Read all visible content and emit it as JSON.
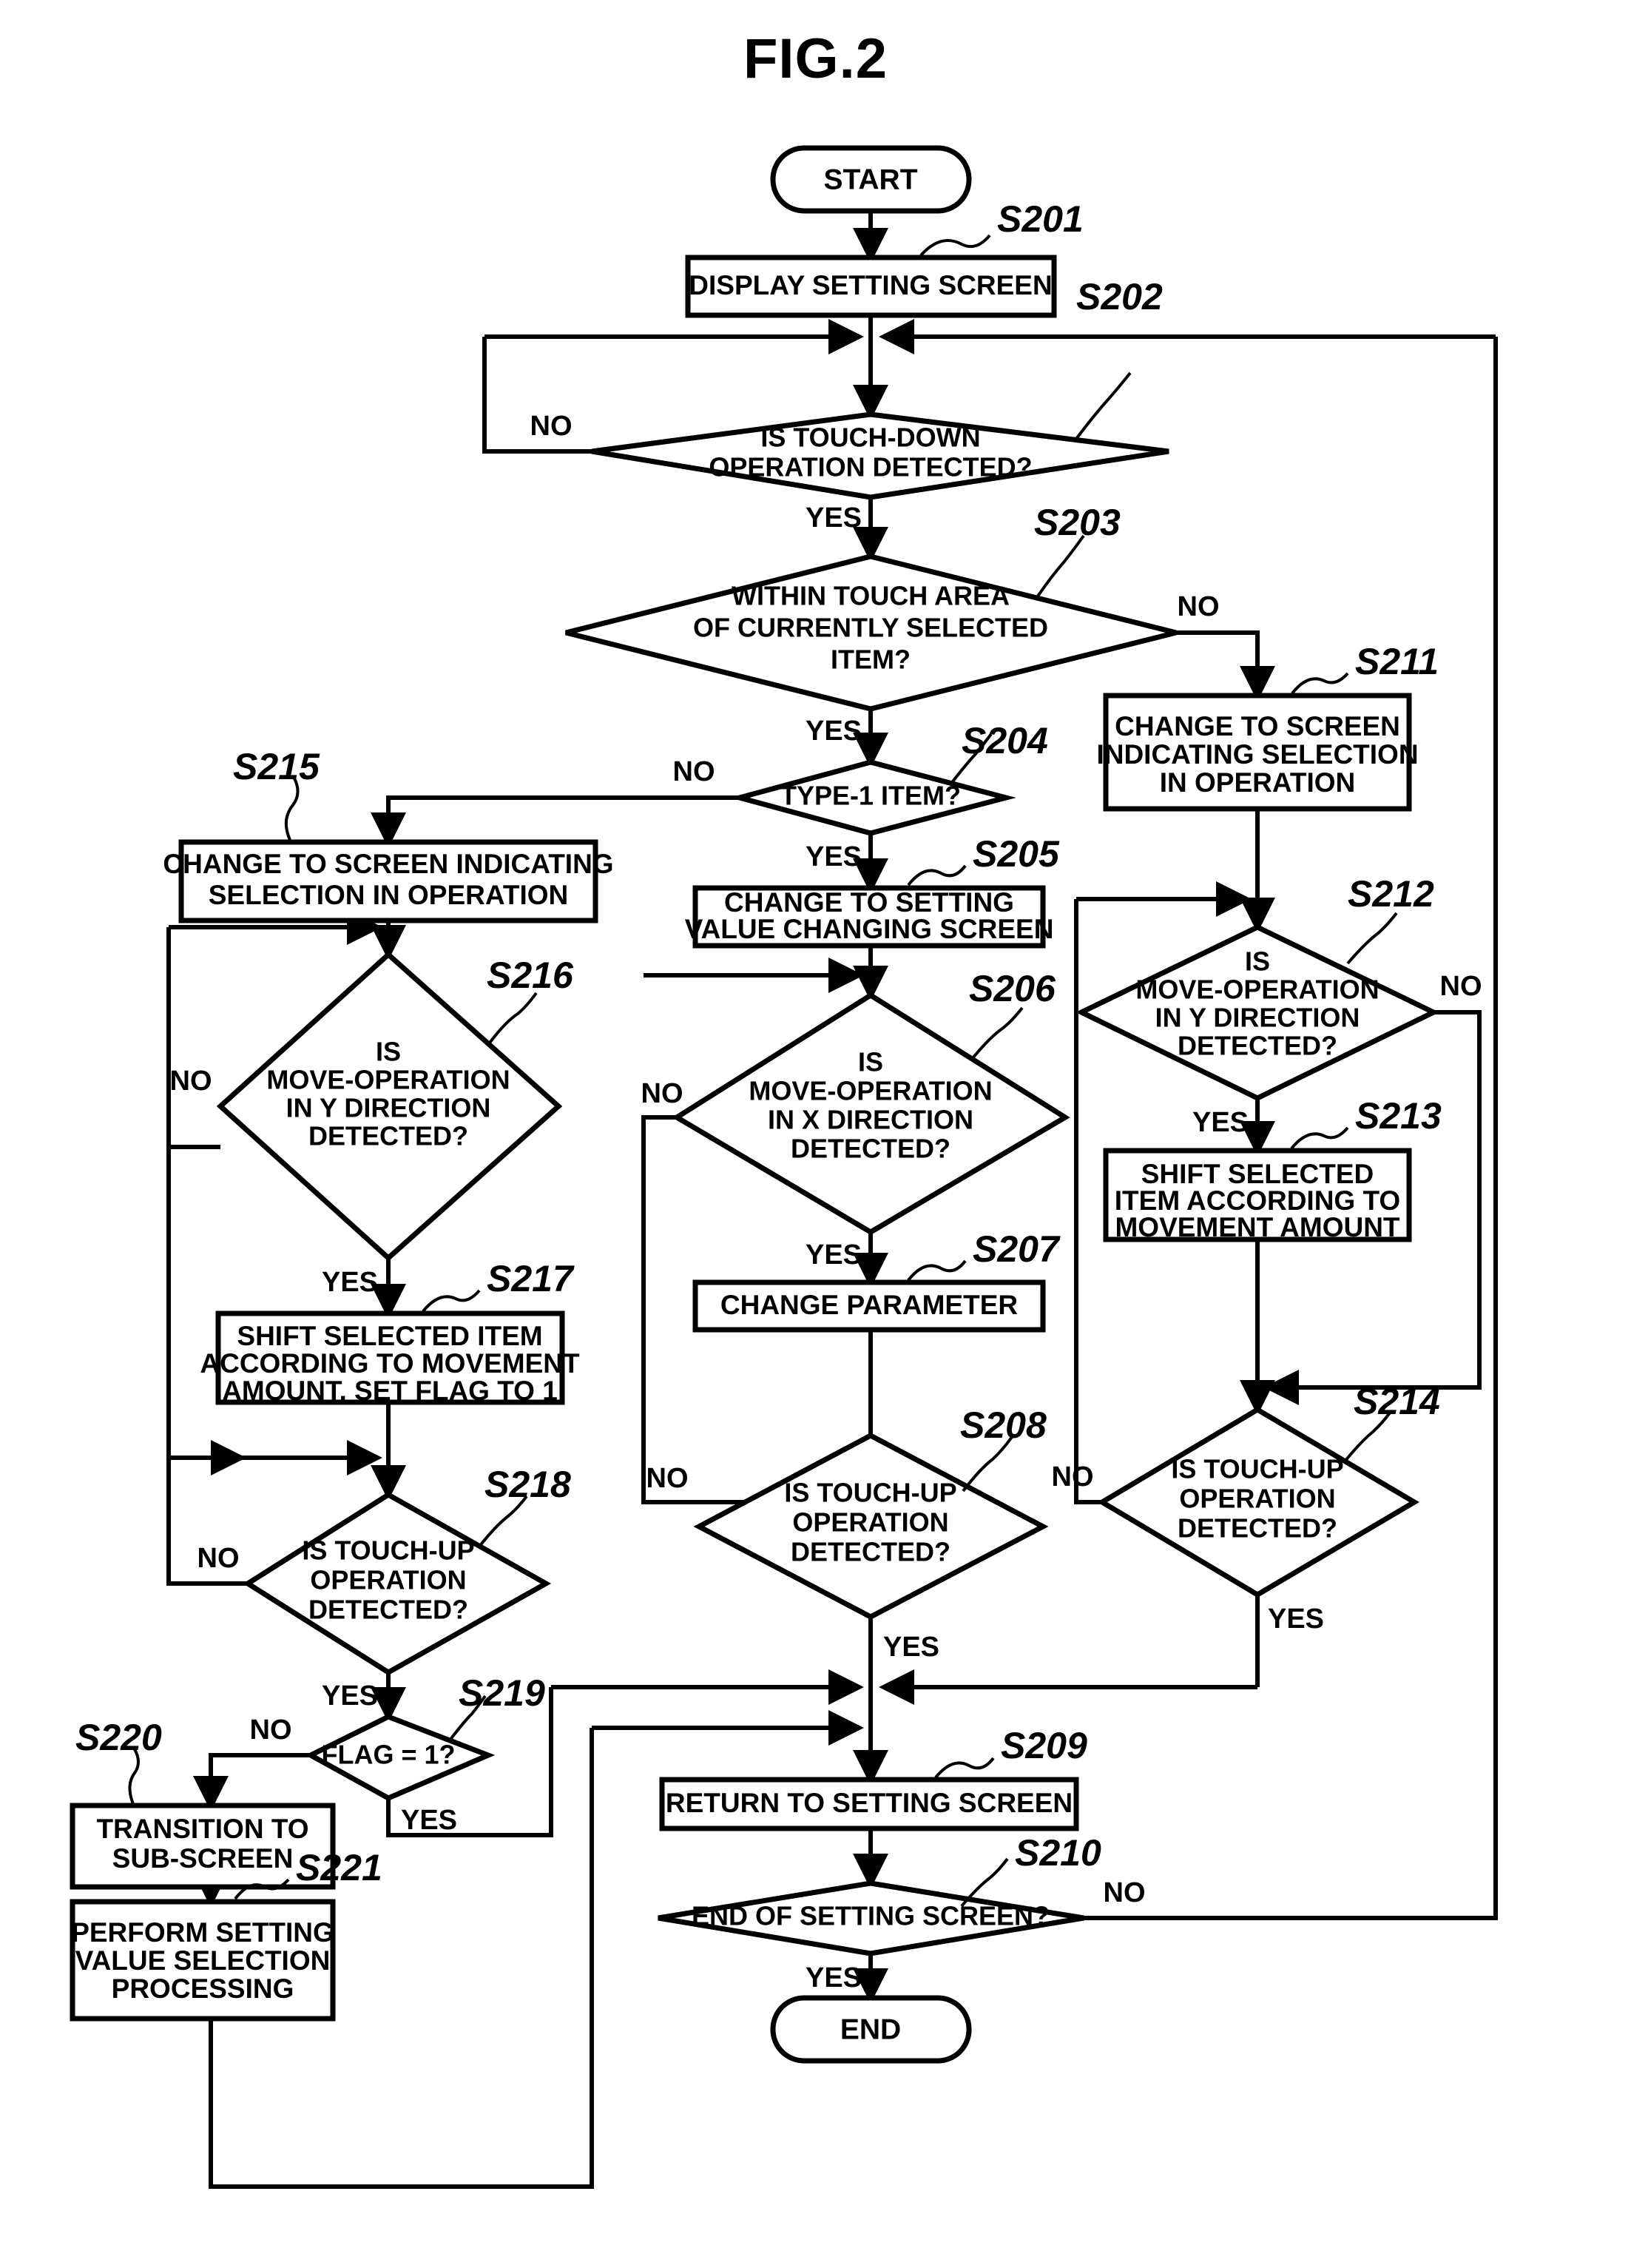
{
  "figure": {
    "title": "FIG.2"
  },
  "diagram_type": "flowchart",
  "terminals": {
    "start": "START",
    "end": "END"
  },
  "branches": {
    "yes": "YES",
    "no": "NO"
  },
  "steps": [
    {
      "id": "S201",
      "kind": "process",
      "text_lines": [
        "DISPLAY SETTING SCREEN"
      ]
    },
    {
      "id": "S202",
      "kind": "decision",
      "text_lines": [
        "IS TOUCH-DOWN",
        "OPERATION DETECTED?"
      ]
    },
    {
      "id": "S203",
      "kind": "decision",
      "text_lines": [
        "WITHIN TOUCH AREA",
        "OF CURRENTLY SELECTED",
        "ITEM?"
      ]
    },
    {
      "id": "S204",
      "kind": "decision",
      "text_lines": [
        "TYPE-1 ITEM?"
      ]
    },
    {
      "id": "S205",
      "kind": "process",
      "text_lines": [
        "CHANGE TO SETTING",
        "VALUE CHANGING SCREEN"
      ]
    },
    {
      "id": "S206",
      "kind": "decision",
      "text_lines": [
        "IS",
        "MOVE-OPERATION",
        "IN X DIRECTION",
        "DETECTED?"
      ]
    },
    {
      "id": "S207",
      "kind": "process",
      "text_lines": [
        "CHANGE PARAMETER"
      ]
    },
    {
      "id": "S208",
      "kind": "decision",
      "text_lines": [
        "IS TOUCH-UP",
        "OPERATION",
        "DETECTED?"
      ]
    },
    {
      "id": "S209",
      "kind": "process",
      "text_lines": [
        "RETURN TO SETTING SCREEN"
      ]
    },
    {
      "id": "S210",
      "kind": "decision",
      "text_lines": [
        "END OF SETTING SCREEN?"
      ]
    },
    {
      "id": "S211",
      "kind": "process",
      "text_lines": [
        "CHANGE TO SCREEN",
        "INDICATING SELECTION",
        "IN OPERATION"
      ]
    },
    {
      "id": "S212",
      "kind": "decision",
      "text_lines": [
        "IS",
        "MOVE-OPERATION",
        "IN Y DIRECTION",
        "DETECTED?"
      ]
    },
    {
      "id": "S213",
      "kind": "process",
      "text_lines": [
        "SHIFT SELECTED",
        "ITEM ACCORDING TO",
        "MOVEMENT AMOUNT"
      ]
    },
    {
      "id": "S214",
      "kind": "decision",
      "text_lines": [
        "IS TOUCH-UP",
        "OPERATION",
        "DETECTED?"
      ]
    },
    {
      "id": "S215",
      "kind": "process",
      "text_lines": [
        "CHANGE TO SCREEN INDICATING",
        "SELECTION IN OPERATION"
      ]
    },
    {
      "id": "S216",
      "kind": "decision",
      "text_lines": [
        "IS",
        "MOVE-OPERATION",
        "IN Y DIRECTION",
        "DETECTED?"
      ]
    },
    {
      "id": "S217",
      "kind": "process",
      "text_lines": [
        "SHIFT SELECTED ITEM",
        "ACCORDING TO MOVEMENT",
        "AMOUNT, SET FLAG TO 1"
      ]
    },
    {
      "id": "S218",
      "kind": "decision",
      "text_lines": [
        "IS TOUCH-UP",
        "OPERATION",
        "DETECTED?"
      ]
    },
    {
      "id": "S219",
      "kind": "decision",
      "text_lines": [
        "FLAG = 1?"
      ]
    },
    {
      "id": "S220",
      "kind": "process",
      "text_lines": [
        "TRANSITION TO",
        "SUB-SCREEN"
      ]
    },
    {
      "id": "S221",
      "kind": "process",
      "text_lines": [
        "PERFORM SETTING",
        "VALUE SELECTION",
        "PROCESSING"
      ]
    }
  ],
  "branch_labels": [
    {
      "from": "S202",
      "label": "NO",
      "direction": "left"
    },
    {
      "from": "S202",
      "label": "YES",
      "direction": "down"
    },
    {
      "from": "S203",
      "label": "NO",
      "direction": "right"
    },
    {
      "from": "S203",
      "label": "YES",
      "direction": "down"
    },
    {
      "from": "S204",
      "label": "NO",
      "direction": "left"
    },
    {
      "from": "S204",
      "label": "YES",
      "direction": "down"
    },
    {
      "from": "S206",
      "label": "NO",
      "direction": "left"
    },
    {
      "from": "S206",
      "label": "YES",
      "direction": "down"
    },
    {
      "from": "S208",
      "label": "NO",
      "direction": "left"
    },
    {
      "from": "S208",
      "label": "YES",
      "direction": "down"
    },
    {
      "from": "S210",
      "label": "NO",
      "direction": "right"
    },
    {
      "from": "S210",
      "label": "YES",
      "direction": "down"
    },
    {
      "from": "S212",
      "label": "NO",
      "direction": "right"
    },
    {
      "from": "S212",
      "label": "YES",
      "direction": "down"
    },
    {
      "from": "S214",
      "label": "NO",
      "direction": "left"
    },
    {
      "from": "S214",
      "label": "YES",
      "direction": "down"
    },
    {
      "from": "S216",
      "label": "NO",
      "direction": "left"
    },
    {
      "from": "S216",
      "label": "YES",
      "direction": "down"
    },
    {
      "from": "S218",
      "label": "NO",
      "direction": "left"
    },
    {
      "from": "S218",
      "label": "YES",
      "direction": "down"
    },
    {
      "from": "S219",
      "label": "NO",
      "direction": "left"
    },
    {
      "from": "S219",
      "label": "YES",
      "direction": "down"
    }
  ],
  "colors": {
    "ink": "#000000",
    "paper": "#ffffff"
  }
}
